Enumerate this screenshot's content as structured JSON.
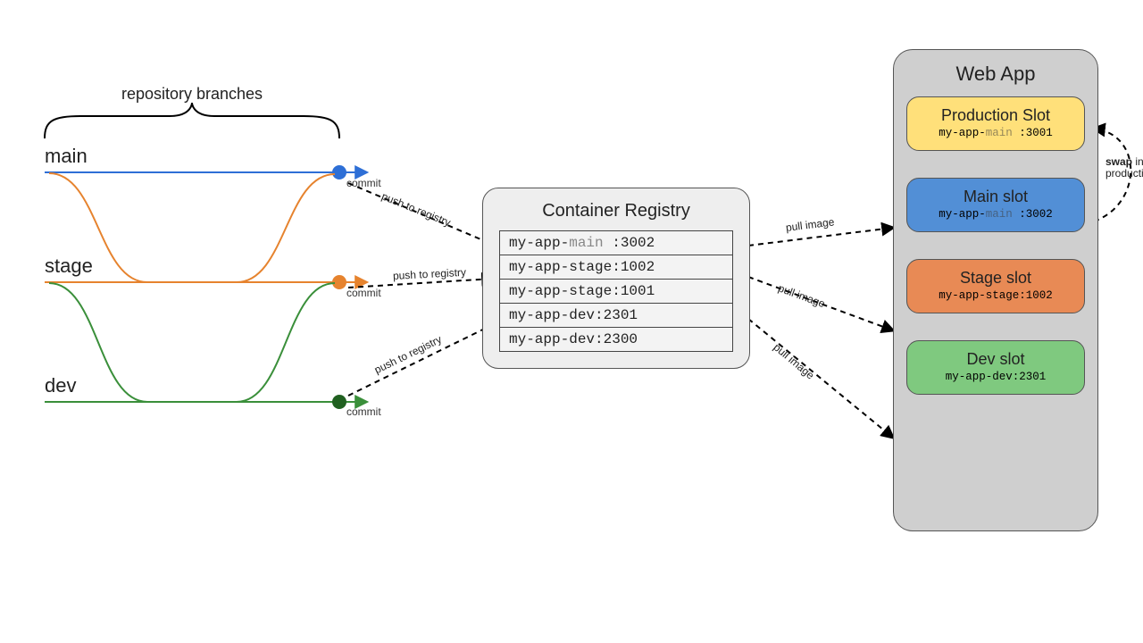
{
  "brace_label": "repository branches",
  "branches": {
    "main": {
      "label": "main",
      "commit": "commit",
      "push_label": "push to registry",
      "color": "#2e6fd6"
    },
    "stage": {
      "label": "stage",
      "commit": "commit",
      "push_label": "push to registry",
      "color": "#e6832e"
    },
    "dev": {
      "label": "dev",
      "commit": "commit",
      "push_label": "push to registry",
      "color": "#3a8f3a"
    }
  },
  "registry": {
    "title": "Container Registry",
    "rows": [
      {
        "text_pre": "my-app-",
        "grey": "main ",
        "text_post": ":3002"
      },
      {
        "text_pre": "my-app-stage:1002"
      },
      {
        "text_pre": "my-app-stage:1001"
      },
      {
        "text_pre": "my-app-dev:2301"
      },
      {
        "text_pre": "my-app-dev:2300"
      }
    ]
  },
  "pull_labels": {
    "main": "pull image",
    "stage": "pull image",
    "dev": "pull image"
  },
  "webapp": {
    "title": "Web App",
    "slots": {
      "prod": {
        "title": "Production Slot",
        "tag_pre": "my-app-",
        "tag_grey": "main ",
        "tag_post": ":3001"
      },
      "main": {
        "title": "Main slot",
        "tag_pre": "my-app-",
        "tag_grey": "main ",
        "tag_post": ":3002"
      },
      "stage": {
        "title": "Stage slot",
        "tag_pre": "my-app-stage:1002"
      },
      "dev": {
        "title": "Dev slot",
        "tag_pre": "my-app-dev:2301"
      }
    },
    "swap_label_html": "<b>swap</b> into production"
  },
  "colors": {
    "main": "#2e6fd6",
    "stage": "#e6832e",
    "dev": "#3a8f3a",
    "slot_prod": "#ffe07a",
    "slot_main": "#528fd6",
    "slot_stage": "#e88a55",
    "slot_dev": "#7fc97f"
  }
}
